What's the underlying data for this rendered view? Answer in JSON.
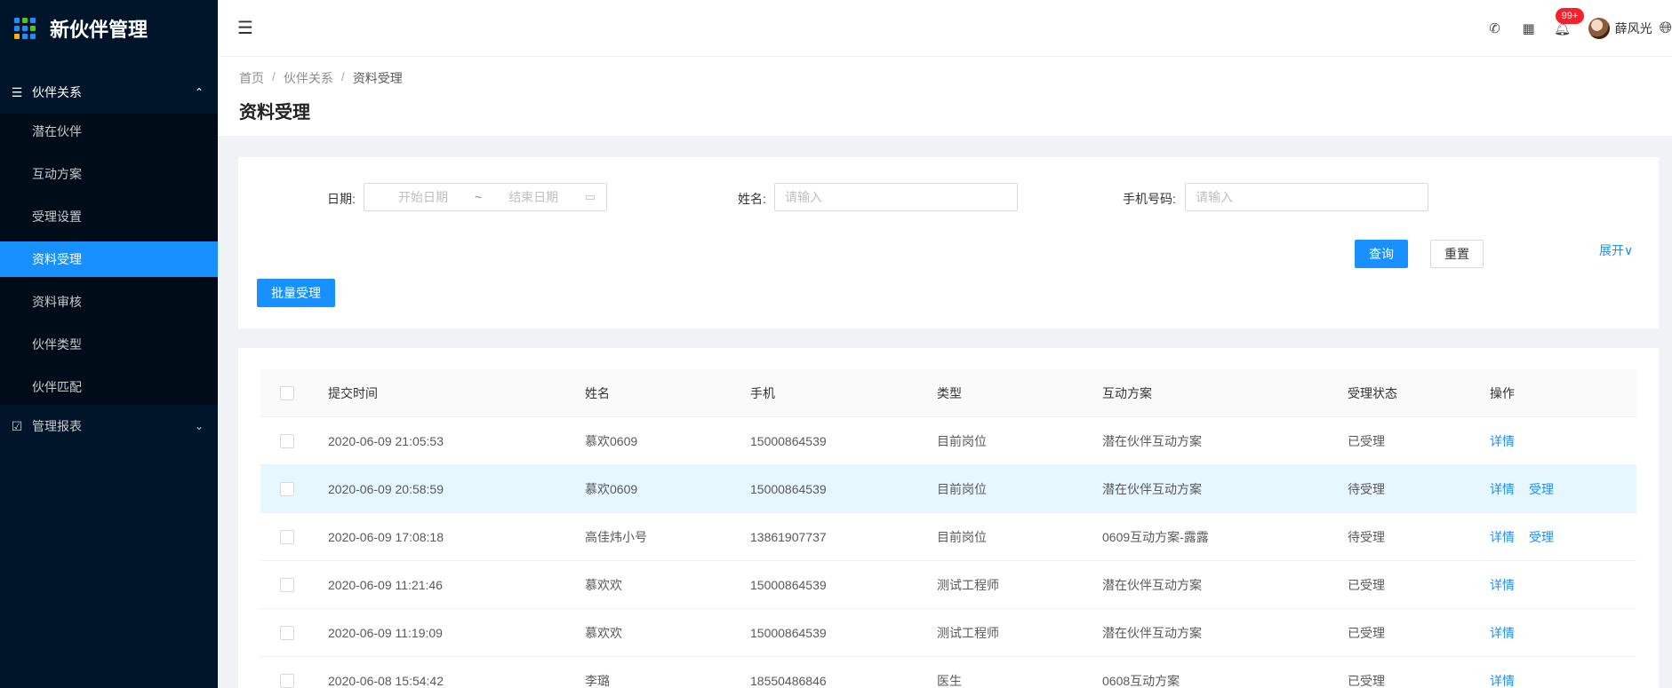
{
  "sidebar": {
    "title": "新伙伴管理",
    "group1": {
      "label": "伙伴关系",
      "icon": "menu-icon"
    },
    "items": [
      "潜在伙伴",
      "互动方案",
      "受理设置",
      "资料受理",
      "资料审核",
      "伙伴类型",
      "伙伴匹配"
    ],
    "active_index": 3,
    "group2": {
      "label": "管理报表",
      "icon": "chart-icon"
    }
  },
  "header": {
    "badge": "99+",
    "username": "薛风光"
  },
  "breadcrumb": [
    "首页",
    "伙伴关系",
    "资料受理"
  ],
  "page_title": "资料受理",
  "filter": {
    "date_label": "日期:",
    "start_placeholder": "开始日期",
    "tilde": "~",
    "end_placeholder": "结束日期",
    "name_label": "姓名:",
    "name_placeholder": "请输入",
    "phone_label": "手机号码:",
    "phone_placeholder": "请输入",
    "query": "查询",
    "reset": "重置",
    "expand": "展开",
    "batch": "批量受理"
  },
  "table": {
    "columns": [
      "提交时间",
      "姓名",
      "手机",
      "类型",
      "互动方案",
      "受理状态",
      "操作"
    ],
    "rows": [
      {
        "time": "2020-06-09 21:05:53",
        "name": "慕欢0609",
        "phone": "15000864539",
        "type": "目前岗位",
        "plan": "潜在伙伴互动方案",
        "status": "已受理",
        "ops": [
          "详情"
        ]
      },
      {
        "time": "2020-06-09 20:58:59",
        "name": "慕欢0609",
        "phone": "15000864539",
        "type": "目前岗位",
        "plan": "潜在伙伴互动方案",
        "status": "待受理",
        "ops": [
          "详情",
          "受理"
        ]
      },
      {
        "time": "2020-06-09 17:08:18",
        "name": "高佳炜小号",
        "phone": "13861907737",
        "type": "目前岗位",
        "plan": "0609互动方案-露露",
        "status": "待受理",
        "ops": [
          "详情",
          "受理"
        ]
      },
      {
        "time": "2020-06-09 11:21:46",
        "name": "慕欢欢",
        "phone": "15000864539",
        "type": "测试工程师",
        "plan": "潜在伙伴互动方案",
        "status": "已受理",
        "ops": [
          "详情"
        ]
      },
      {
        "time": "2020-06-09 11:19:09",
        "name": "慕欢欢",
        "phone": "15000864539",
        "type": "测试工程师",
        "plan": "潜在伙伴互动方案",
        "status": "已受理",
        "ops": [
          "详情"
        ]
      },
      {
        "time": "2020-06-08 15:54:42",
        "name": "李璐",
        "phone": "18550486846",
        "type": "医生",
        "plan": "0608互动方案",
        "status": "已受理",
        "ops": [
          "详情"
        ]
      }
    ],
    "hover_row": 1
  },
  "colors": {
    "primary": "#1890ff",
    "sidebar_bg": "#001529",
    "submenu_bg": "#000c17",
    "badge": "#f5222d",
    "hover_row": "#e6f7ff"
  }
}
